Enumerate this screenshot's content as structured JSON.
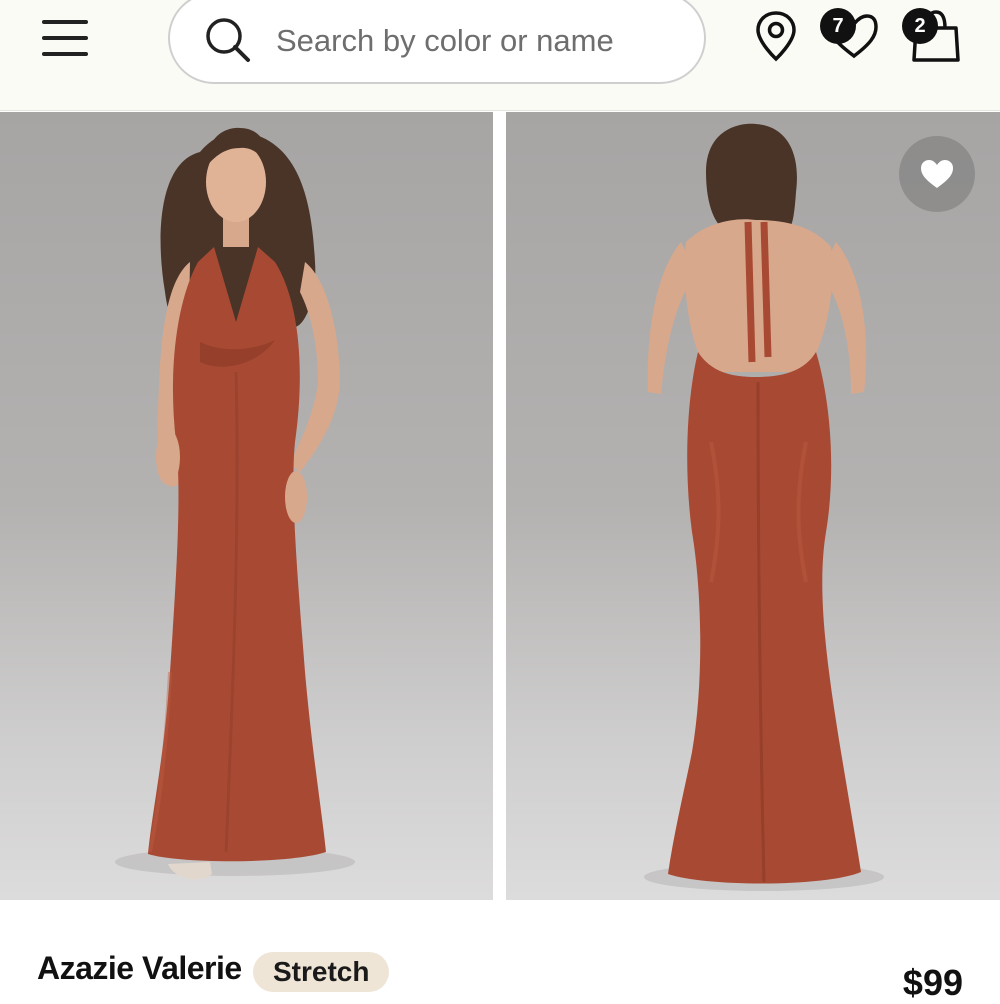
{
  "header": {
    "search_placeholder": "Search by color or name",
    "wishlist_count": "7",
    "cart_count": "2"
  },
  "gallery": {
    "images": [
      {
        "alt": "Model wearing rust satin halter gown, front view"
      },
      {
        "alt": "Model wearing rust satin halter gown, back view"
      }
    ]
  },
  "product": {
    "name": "Azazie Valerie",
    "tag": "Stretch",
    "price": "$99"
  },
  "colors": {
    "dress": "#a84a33",
    "accent_dark": "#111111",
    "tag_bg": "#efe5d6"
  }
}
